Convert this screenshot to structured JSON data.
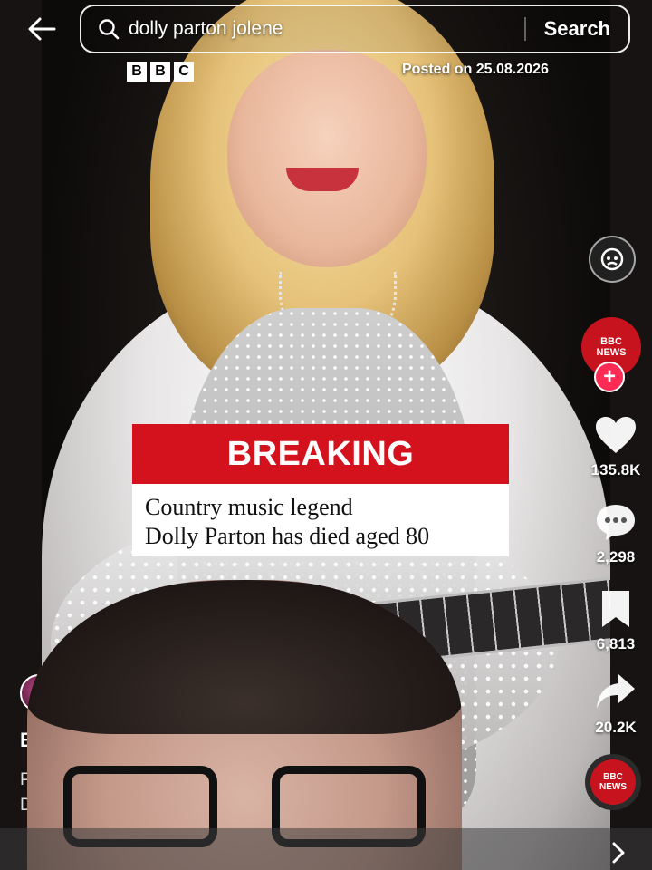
{
  "search": {
    "query": "dolly parton jolene",
    "button_label": "Search"
  },
  "overlay": {
    "logo_letters": [
      "B",
      "B",
      "C"
    ],
    "posted_text": "Posted on 25.08.2026",
    "breaking_label": "BREAKING",
    "headline_line1": "Country music legend",
    "headline_line2": "Dolly Parton has died aged 80"
  },
  "rail": {
    "creator_badge_line1": "BBC",
    "creator_badge_line2": "NEWS",
    "follow_symbol": "+",
    "likes": "135.8K",
    "comments": "2,298",
    "saves": "6,813",
    "shares": "20.2K",
    "music_disc_line1": "BBC",
    "music_disc_line2": "NEWS"
  },
  "left": {
    "username_partial": "BE",
    "caption_line1_partial": "Po",
    "caption_line2_partial": "D"
  },
  "icons": {
    "back": "arrow-left-icon",
    "search": "search-icon",
    "like": "heart-icon",
    "comment": "comment-icon",
    "save": "bookmark-icon",
    "share": "share-icon",
    "chevron": "chevron-right-icon"
  },
  "colors": {
    "breaking_red": "#d4121e",
    "bbc_red": "#c7131d",
    "follow_pink": "#fe2c55"
  }
}
